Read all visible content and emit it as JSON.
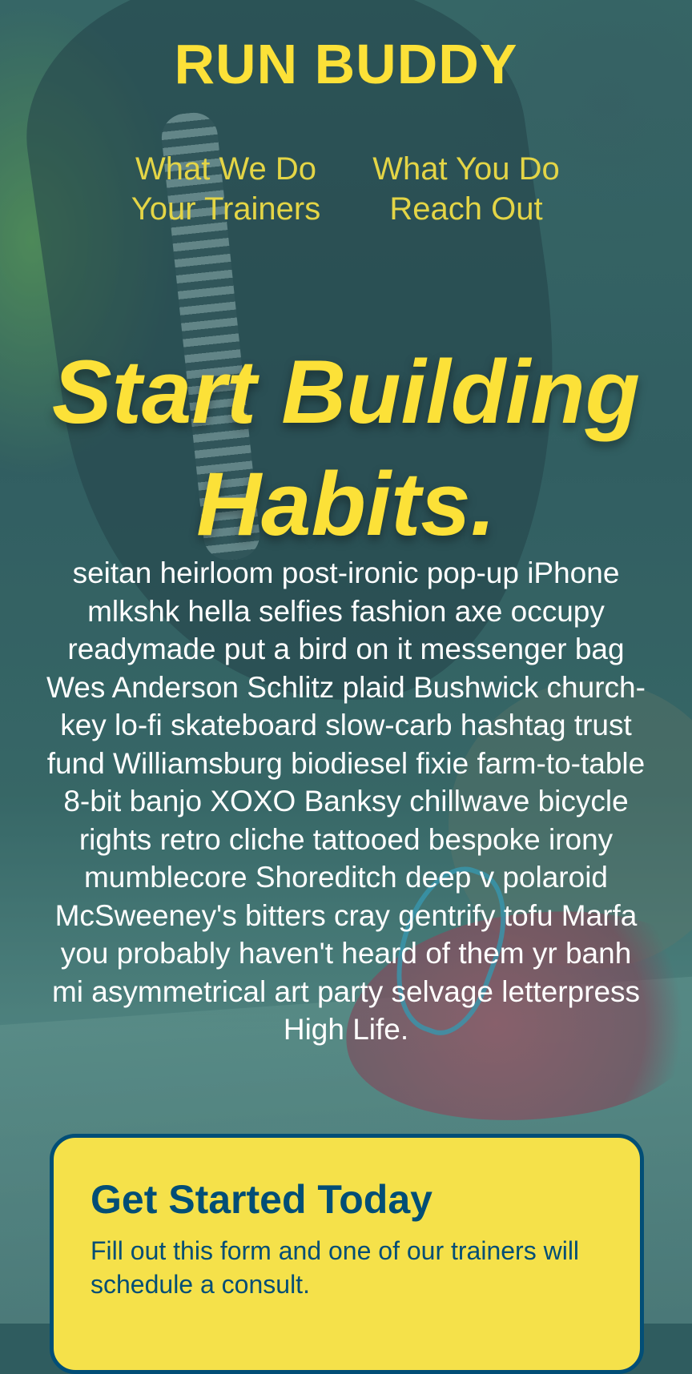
{
  "header": {
    "brand": "RUN BUDDY",
    "nav": [
      {
        "label": "What We Do"
      },
      {
        "label": "What You Do"
      },
      {
        "label": "Your Trainers"
      },
      {
        "label": "Reach Out"
      }
    ]
  },
  "hero": {
    "title": "Start Building Habits.",
    "body": "seitan heirloom post-ironic pop-up iPhone mlkshk hella selfies fashion axe occupy readymade put a bird on it messenger bag Wes Anderson Schlitz plaid Bushwick church-key lo-fi skateboard slow-carb hashtag trust fund Williamsburg biodiesel fixie farm-to-table 8-bit banjo XOXO Banksy chillwave bicycle rights retro cliche tattooed bespoke irony mumblecore Shoreditch deep v polaroid McSweeney's bitters cray gentrify tofu Marfa you probably haven't heard of them yr banh mi asymmetrical art party selvage letterpress High Life."
  },
  "form": {
    "title": "Get Started Today",
    "subtext": "Fill out this form and one of our trainers will schedule a consult."
  },
  "colors": {
    "brand_yellow": "#fce138",
    "brand_blue": "#024e76"
  }
}
